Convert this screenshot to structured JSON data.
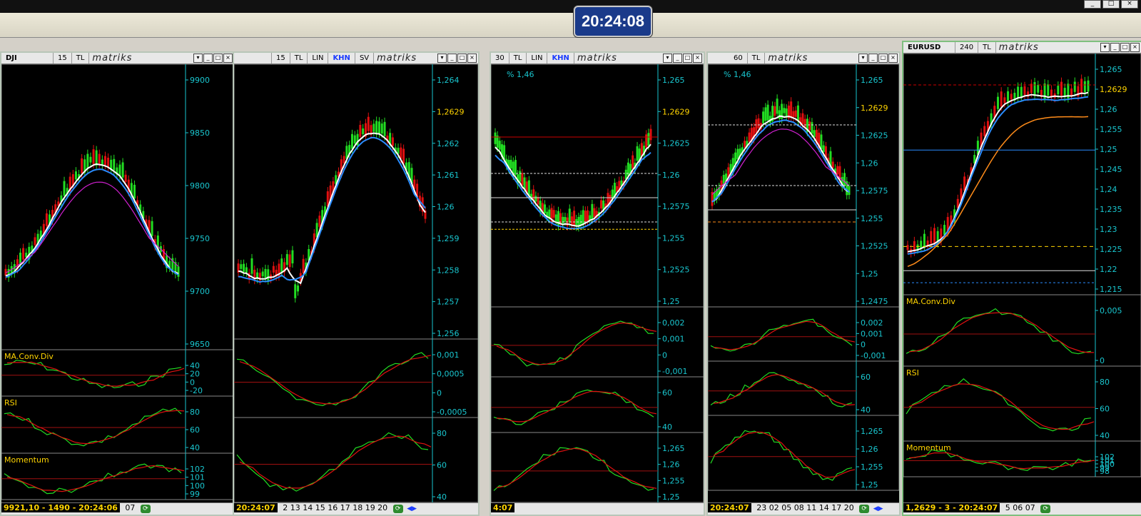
{
  "app": {
    "clock": "20:24:08",
    "brand": "matriks",
    "window_controls": [
      "_",
      "□",
      "×"
    ]
  },
  "windows": [
    {
      "title": {
        "symbol": "DJI",
        "period": "15",
        "currency": "TL",
        "brand": "matriks"
      },
      "price_axis": [
        "9900",
        "9850",
        "9800",
        "9750",
        "9700",
        "9650"
      ],
      "last_price": "9921,1",
      "indicators": [
        {
          "name": "MA.Conv.Div",
          "axis": [
            "40",
            "20",
            "0",
            "-20"
          ]
        },
        {
          "name": "RSI",
          "axis": [
            "80",
            "60",
            "40"
          ]
        },
        {
          "name": "Momentum",
          "axis": [
            "102",
            "101",
            "100",
            "99"
          ]
        }
      ],
      "status": {
        "value": "9921,10 - 1490 - 20:24:06",
        "dates": "07"
      }
    },
    {
      "title": {
        "symbol": "",
        "period": "15",
        "currency": "TL",
        "scale": "LIN",
        "khn": "KHN",
        "sv": "SV",
        "brand": "matriks"
      },
      "price_axis": [
        "1,264",
        "1,2629",
        "1,262",
        "1,261",
        "1,26",
        "1,259",
        "1,258",
        "1,257",
        "1,256"
      ],
      "last_price": "1,2629",
      "indicators": [
        {
          "name": "",
          "axis": [
            "0,001",
            "0,0005",
            "0",
            "-0,0005"
          ]
        },
        {
          "name": "",
          "axis": [
            "80",
            "60",
            "40"
          ]
        }
      ],
      "status": {
        "value": "20:24:07",
        "dates": "2 13 14 15 16 17 18 19 20"
      }
    },
    {
      "title": {
        "symbol": "",
        "period": "30",
        "currency": "TL",
        "scale": "LIN",
        "khn": "KHN",
        "brand": "matriks"
      },
      "price_axis": [
        "1,265",
        "1,2629",
        "1,2625",
        "1,26",
        "1,2575",
        "1,255",
        "1,2525",
        "1,25"
      ],
      "last_price": "1,2629",
      "annotation": "% 1,46",
      "indicators": [
        {
          "name": "",
          "axis": [
            "0,002",
            "0,001",
            "0",
            "-0,001"
          ]
        },
        {
          "name": "",
          "axis": [
            "60",
            "40"
          ]
        },
        {
          "name": "",
          "axis": [
            "1,265",
            "1,26",
            "1,255",
            "1,25"
          ]
        }
      ],
      "status": {
        "value": "4:07",
        "dates": ""
      }
    },
    {
      "title": {
        "symbol": "",
        "period": "60",
        "currency": "TL",
        "brand": "matriks"
      },
      "price_axis": [
        "1,265",
        "1,2629",
        "1,2625",
        "1,26",
        "1,2575",
        "1,255",
        "1,2525",
        "1,25",
        "1,2475"
      ],
      "last_price": "1,2629",
      "annotation": "% 1,46",
      "indicators": [
        {
          "name": "",
          "axis": [
            "0,002",
            "0,001",
            "0",
            "-0,001"
          ]
        },
        {
          "name": "",
          "axis": [
            "60",
            "40"
          ]
        },
        {
          "name": "",
          "axis": [
            "1,265",
            "1,26",
            "1,255",
            "1,25"
          ]
        }
      ],
      "status": {
        "value": "20:24:07",
        "dates": "23 02 05 08 11 14 17 20"
      }
    },
    {
      "title": {
        "symbol": "EURUSD",
        "period": "240",
        "currency": "TL",
        "brand": "matriks"
      },
      "price_axis": [
        "1,265",
        "1,2629",
        "1,26",
        "1,255",
        "1,25",
        "1,245",
        "1,24",
        "1,235",
        "1,23",
        "1,225",
        "1,22",
        "1,215"
      ],
      "last_price": "1,2629",
      "indicators": [
        {
          "name": "MA.Conv.Div",
          "axis": [
            "0,005",
            "0"
          ]
        },
        {
          "name": "RSI",
          "axis": [
            "80",
            "60",
            "40"
          ]
        },
        {
          "name": "Momentum",
          "axis": [
            "102",
            "101",
            "100",
            "99",
            "98"
          ]
        }
      ],
      "status": {
        "value": "1,2629 - 3 - 20:24:07",
        "dates": "5 06 07"
      }
    }
  ],
  "colors": {
    "background": "#000000",
    "axis_text": "#19c6cf",
    "bull_candle": "#22dd22",
    "bear_candle": "#e01010",
    "ma_white": "#ffffff",
    "ma_blue": "#2a8cff",
    "ma_magenta": "#d020d0",
    "signal_red": "#e01010",
    "signal_green": "#22dd22",
    "label_yellow": "#ffd400",
    "ma_orange": "#ff8c1a"
  }
}
